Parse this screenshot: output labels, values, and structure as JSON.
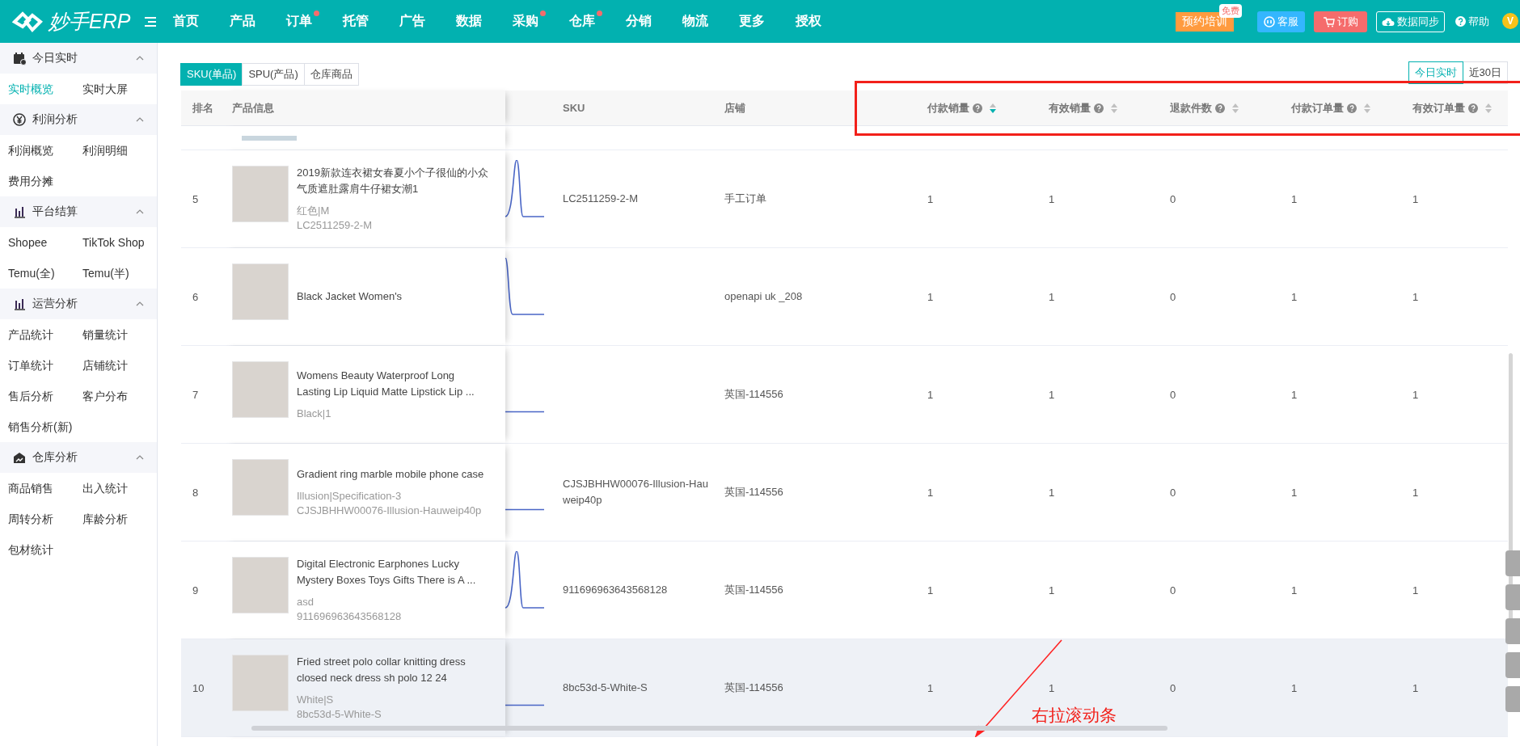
{
  "topbar": {
    "logo": "妙手ERP",
    "nav": [
      {
        "label": "首页",
        "dot": false
      },
      {
        "label": "产品",
        "dot": false
      },
      {
        "label": "订单",
        "dot": true
      },
      {
        "label": "托管",
        "dot": false
      },
      {
        "label": "广告",
        "dot": false
      },
      {
        "label": "数据",
        "dot": false
      },
      {
        "label": "采购",
        "dot": true
      },
      {
        "label": "仓库",
        "dot": true
      },
      {
        "label": "分销",
        "dot": false
      },
      {
        "label": "物流",
        "dot": false
      },
      {
        "label": "更多",
        "dot": false
      },
      {
        "label": "授权",
        "dot": false
      }
    ],
    "actions": [
      {
        "kind": "training",
        "label": "预约培训",
        "badge": "免费"
      },
      {
        "kind": "service",
        "label": "客服"
      },
      {
        "kind": "order",
        "label": "订购"
      },
      {
        "kind": "sync",
        "label": "数据同步"
      },
      {
        "kind": "help",
        "label": "帮助"
      }
    ],
    "avatar": "V"
  },
  "sidebar": {
    "groups": [
      {
        "title": "今日实时",
        "expanded": true,
        "items": [
          {
            "label": "实时概览",
            "selected": true
          },
          {
            "label": "实时大屏",
            "selected": false
          }
        ]
      },
      {
        "title": "利润分析",
        "expanded": true,
        "items": [
          {
            "label": "利润概览",
            "selected": false
          },
          {
            "label": "利润明细",
            "selected": false
          },
          {
            "label": "费用分摊",
            "selected": false
          }
        ]
      },
      {
        "title": "平台结算",
        "expanded": true,
        "items": [
          {
            "label": "Shopee",
            "selected": false
          },
          {
            "label": "TikTok Shop",
            "selected": false
          },
          {
            "label": "Temu(全)",
            "selected": false
          },
          {
            "label": "Temu(半)",
            "selected": false
          }
        ]
      },
      {
        "title": "运营分析",
        "expanded": true,
        "items": [
          {
            "label": "产品统计",
            "selected": false
          },
          {
            "label": "销量统计",
            "selected": false
          },
          {
            "label": "订单统计",
            "selected": false
          },
          {
            "label": "店铺统计",
            "selected": false
          },
          {
            "label": "售后分析",
            "selected": false
          },
          {
            "label": "客户分布",
            "selected": false
          },
          {
            "label": "销售分析(新)",
            "selected": false
          }
        ]
      },
      {
        "title": "仓库分析",
        "expanded": true,
        "items": [
          {
            "label": "商品销售",
            "selected": false
          },
          {
            "label": "出入统计",
            "selected": false
          },
          {
            "label": "周转分析",
            "selected": false
          },
          {
            "label": "库龄分析",
            "selected": false
          },
          {
            "label": "包材统计",
            "selected": false
          }
        ]
      }
    ]
  },
  "view_tabs": [
    {
      "label": "SKU(单品)",
      "selected": true
    },
    {
      "label": "SPU(产品)",
      "selected": false
    },
    {
      "label": "仓库商品",
      "selected": false
    }
  ],
  "range_tabs": [
    {
      "label": "今日实时",
      "selected": true
    },
    {
      "label": "近30日",
      "selected": false
    }
  ],
  "table": {
    "columns": [
      {
        "kind": "rank",
        "label": "排名"
      },
      {
        "kind": "info",
        "label": "产品信息"
      },
      {
        "kind": "trend"
      },
      {
        "kind": "text",
        "label": "SKU"
      },
      {
        "kind": "text",
        "label": "店铺"
      },
      {
        "kind": "metric",
        "label": "付款销量",
        "sorted": true
      },
      {
        "kind": "metric",
        "label": "有效销量",
        "sorted": false
      },
      {
        "kind": "metric",
        "label": "退款件数",
        "sorted": false
      },
      {
        "kind": "metric",
        "label": "付款订单量",
        "sorted": false
      },
      {
        "kind": "metric",
        "label": "有效订单量",
        "sorted": false
      }
    ],
    "rows": [
      {
        "rank": "5",
        "title": "2019新款连衣裙女春夏小个子很仙的小众气质遮肚露肩牛仔裙女潮1",
        "variant": "红色|M",
        "code": "LC2511259-2-M",
        "sku": "LC2511259-2-M",
        "shop": "手工订单",
        "metrics": [
          "1",
          "1",
          "0",
          "1",
          "1"
        ],
        "hovered": false
      },
      {
        "rank": "6",
        "title": "Black Jacket Women's",
        "shop": "openapi uk _208",
        "metrics": [
          "1",
          "1",
          "0",
          "1",
          "1"
        ],
        "hovered": false
      },
      {
        "rank": "7",
        "title": "Womens Beauty Waterproof Long Lasting Lip Liquid Matte Lipstick Lip ...",
        "variant": "Black|1",
        "shop": "英国-114556",
        "metrics": [
          "1",
          "1",
          "0",
          "1",
          "1"
        ],
        "hovered": false
      },
      {
        "rank": "8",
        "title": "Gradient ring marble mobile phone case",
        "variant": "Illusion|Specification-3",
        "code": "CJSJBHHW00076-Illusion-Hauweip40p",
        "sku": "CJSJBHHW00076-Illusion-Hauweip40p",
        "shop": "英国-114556",
        "metrics": [
          "1",
          "1",
          "0",
          "1",
          "1"
        ],
        "hovered": false
      },
      {
        "rank": "9",
        "title": "Digital Electronic Earphones Lucky Mystery Boxes Toys Gifts There is A ...",
        "variant": "asd",
        "code": "911696963643568128",
        "sku": "911696963643568128",
        "shop": "英国-114556",
        "metrics": [
          "1",
          "1",
          "0",
          "1",
          "1"
        ],
        "hovered": false
      },
      {
        "rank": "10",
        "title": "Fried street polo collar knitting dress closed neck dress sh polo 12 24",
        "variant": "White|S",
        "code": "8bc53d-5-White-S",
        "sku": "8bc53d-5-White-S",
        "shop": "英国-114556",
        "metrics": [
          "1",
          "1",
          "0",
          "1",
          "1"
        ],
        "hovered": true
      }
    ]
  },
  "annotation": {
    "text": "右拉滚动条"
  }
}
